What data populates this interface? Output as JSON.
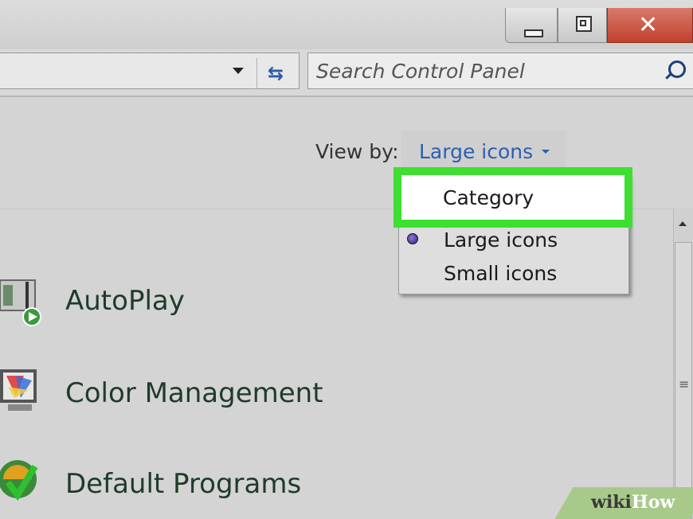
{
  "search": {
    "placeholder": "Search Control Panel"
  },
  "view_by": {
    "label": "View by:",
    "selected": "Large icons"
  },
  "menu": {
    "items": [
      {
        "label": "Category",
        "highlighted": true
      },
      {
        "label": "Large icons",
        "selected": true
      },
      {
        "label": "Small icons"
      }
    ]
  },
  "items": [
    {
      "label": "AutoPlay",
      "icon": "autoplay-icon"
    },
    {
      "label": "Color Management",
      "icon": "color-management-icon"
    },
    {
      "label": "Default Programs",
      "icon": "default-programs-icon"
    }
  ],
  "watermark": {
    "part1": "wiki",
    "part2": "How"
  },
  "colors": {
    "highlight": "#3de030",
    "link": "#2b5fb0",
    "close": "#c0412d"
  }
}
